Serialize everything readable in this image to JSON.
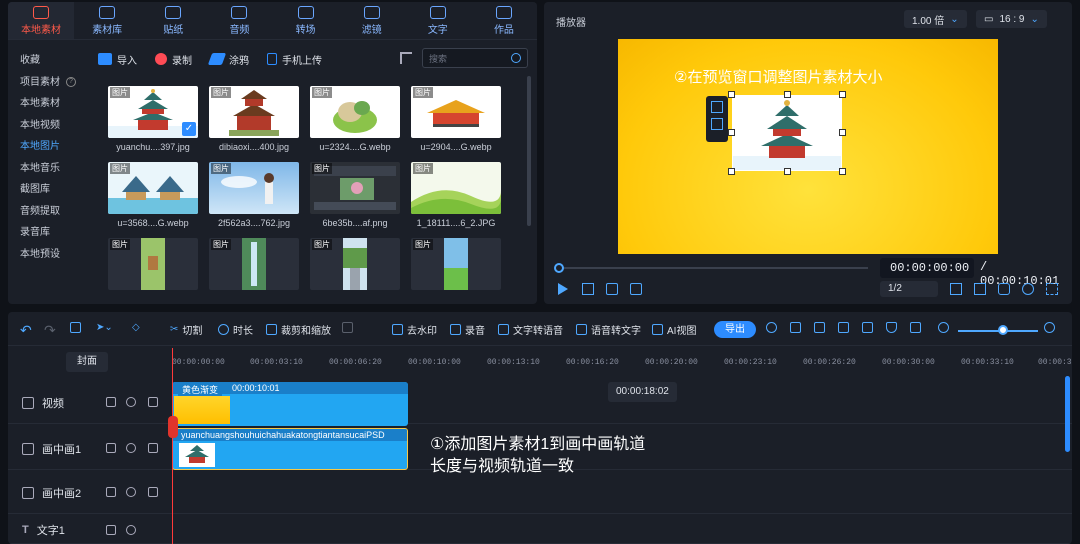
{
  "media_tabs": [
    {
      "label": "本地素材",
      "icon": "folder-icon",
      "active": true
    },
    {
      "label": "素材库",
      "icon": "library-icon"
    },
    {
      "label": "贴纸",
      "icon": "sticker-icon"
    },
    {
      "label": "音频",
      "icon": "music-icon"
    },
    {
      "label": "转场",
      "icon": "transition-icon"
    },
    {
      "label": "滤镜",
      "icon": "filter-icon"
    },
    {
      "label": "文字",
      "icon": "text-icon"
    },
    {
      "label": "作品",
      "icon": "works-icon"
    }
  ],
  "sidebar": [
    {
      "label": "收藏"
    },
    {
      "label": "项目素材"
    },
    {
      "label": "本地素材"
    },
    {
      "label": "本地视频"
    },
    {
      "label": "本地图片",
      "active": true
    },
    {
      "label": "本地音乐"
    },
    {
      "label": "截图库"
    },
    {
      "label": "音频提取"
    },
    {
      "label": "录音库"
    },
    {
      "label": "本地预设"
    }
  ],
  "media_toolbar": {
    "import": "导入",
    "record": "录制",
    "doodle": "涂鸦",
    "phone_upload": "手机上传",
    "search_placeholder": "搜索"
  },
  "thumb_tag": "图片",
  "media_items": [
    {
      "name": "yuanchu....397.jpg",
      "selected": true
    },
    {
      "name": "dibiaoxi....400.jpg"
    },
    {
      "name": "u=2324....G.webp"
    },
    {
      "name": "u=2904....G.webp"
    },
    {
      "name": "u=3568....G.webp"
    },
    {
      "name": "2f562a3....762.jpg"
    },
    {
      "name": "6be35b....af.png"
    },
    {
      "name": "1_18111....6_2.JPG"
    },
    {
      "name": ""
    },
    {
      "name": ""
    },
    {
      "name": ""
    },
    {
      "name": ""
    }
  ],
  "player": {
    "title": "播放器",
    "zoom": "1.00 倍",
    "ratio": "16 : 9",
    "overlay_text": "②在预览窗口调整图片素材大小",
    "current_time": "00:00:00:00",
    "separator": "/",
    "total_time": "00:00:10:01",
    "page": "1/2"
  },
  "editor_toolbar": {
    "cut": "切割",
    "duration": "时长",
    "crop_zoom": "裁剪和缩放",
    "remove_watermark": "去水印",
    "record": "录音",
    "text_to_speech": "文字转语音",
    "speech_to_text": "语音转文字",
    "ai_video": "AI视图",
    "export": "导出"
  },
  "timeline": {
    "cover_label": "封面",
    "ticks": [
      "00:00:00:00",
      "00:00:03:10",
      "00:00:06:20",
      "00:00:10:00",
      "00:00:13:10",
      "00:00:16:20",
      "00:00:20:00",
      "00:00:23:10",
      "00:00:26:20",
      "00:00:30:00",
      "00:00:33:10",
      "00:00:36:"
    ],
    "hover_time": "00:00:18:02",
    "tracks": [
      {
        "label": "视频",
        "icon": "film-icon"
      },
      {
        "label": "画中画1",
        "icon": "pip-icon"
      },
      {
        "label": "画中画2",
        "icon": "pip-icon"
      },
      {
        "label": "文字1",
        "icon": "text-icon"
      }
    ],
    "video_clip": {
      "name": "黄色渐变",
      "duration": "00:00:10:01"
    },
    "pip_clip": {
      "name": "yuanchuangshouhuichahuakatongtiantansucaiPSD"
    },
    "annotation_line1": "①添加图片素材1到画中画轨道",
    "annotation_line2": "长度与视频轨道一致"
  },
  "colors": {
    "accent": "#2d8cff",
    "active_tab": "#ff5a4a",
    "preview_yellow": "#ffc90a",
    "clip_blue": "#22a6f2"
  }
}
